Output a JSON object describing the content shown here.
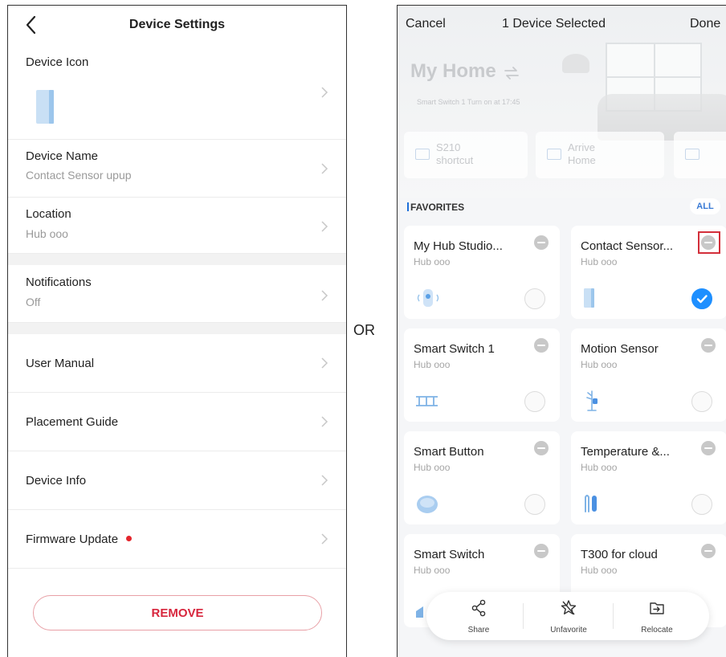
{
  "left_panel": {
    "title": "Device Settings",
    "device_icon_label": "Device Icon",
    "device_name_label": "Device Name",
    "device_name_value": "Contact Sensor upup",
    "location_label": "Location",
    "location_value": "Hub ooo",
    "notifications_label": "Notifications",
    "notifications_value": "Off",
    "user_manual_label": "User Manual",
    "placement_guide_label": "Placement Guide",
    "device_info_label": "Device Info",
    "firmware_update_label": "Firmware Update",
    "remove_label": "REMOVE"
  },
  "separator_text": "OR",
  "right_panel": {
    "cancel_label": "Cancel",
    "selected_label": "1 Device Selected",
    "done_label": "Done",
    "home_title": "My Home",
    "home_subtitle": "Smart Switch 1 Turn on at 17:45",
    "shortcuts": [
      {
        "line1": "S210",
        "line2": "shortcut"
      },
      {
        "line1": "Arrive",
        "line2": "Home"
      }
    ],
    "favorites_label": "FAVORITES",
    "all_label": "ALL",
    "devices": [
      {
        "name": "My Hub Studio...",
        "location": "Hub ooo",
        "selected": false,
        "icon": "hub-icon"
      },
      {
        "name": "Contact Sensor...",
        "location": "Hub ooo",
        "selected": true,
        "icon": "contact-sensor-icon"
      },
      {
        "name": "Smart Switch 1",
        "location": "Hub ooo",
        "selected": false,
        "icon": "switch-icon"
      },
      {
        "name": "Motion Sensor",
        "location": "Hub ooo",
        "selected": false,
        "icon": "motion-sensor-icon"
      },
      {
        "name": "Smart Button",
        "location": "Hub ooo",
        "selected": false,
        "icon": "button-icon"
      },
      {
        "name": "Temperature &...",
        "location": "Hub ooo",
        "selected": false,
        "icon": "temperature-sensor-icon"
      },
      {
        "name": "Smart Switch",
        "location": "Hub ooo",
        "selected": false,
        "icon": "switch-icon"
      },
      {
        "name": "T300 for cloud",
        "location": "Hub ooo",
        "selected": false,
        "icon": "water-leak-sensor-icon"
      }
    ],
    "actions": [
      {
        "label": "Share",
        "icon": "share-icon"
      },
      {
        "label": "Unfavorite",
        "icon": "unfavorite-icon"
      },
      {
        "label": "Relocate",
        "icon": "relocate-icon"
      }
    ]
  },
  "colors": {
    "accent_blue": "#1e8fff",
    "remove_red": "#d7263d",
    "highlight_red": "#d32f3a",
    "device_icon_blue": "#b7d6f2"
  }
}
